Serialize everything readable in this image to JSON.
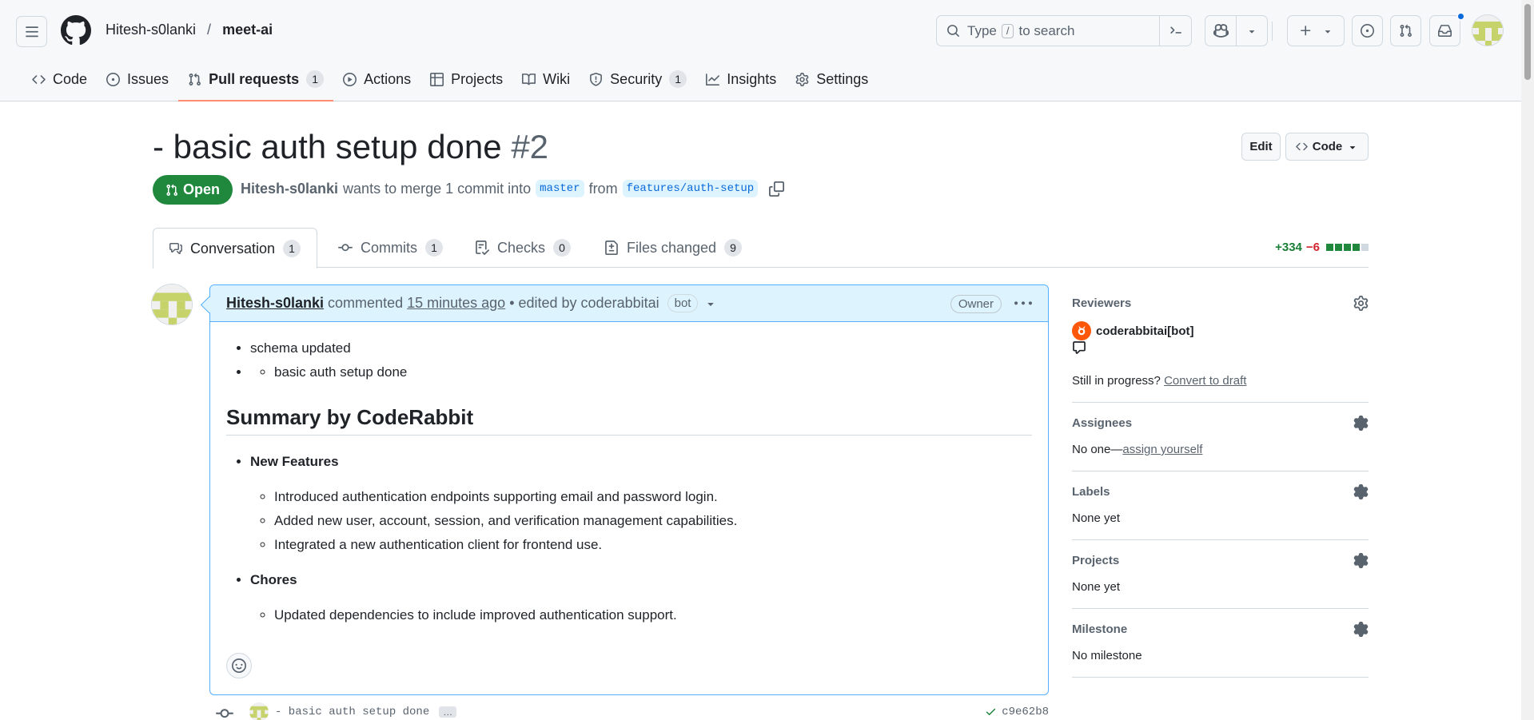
{
  "header": {
    "repo_owner": "Hitesh-s0lanki",
    "repo_separator": "/",
    "repo_name": "meet-ai",
    "search": {
      "prefix": "Type",
      "key": "/",
      "suffix": "to search"
    }
  },
  "repo_nav": [
    {
      "label": "Code",
      "icon": "code-icon"
    },
    {
      "label": "Issues",
      "icon": "issue-opened-icon"
    },
    {
      "label": "Pull requests",
      "icon": "git-pull-request-icon",
      "count": "1",
      "selected": true
    },
    {
      "label": "Actions",
      "icon": "play-icon"
    },
    {
      "label": "Projects",
      "icon": "table-icon"
    },
    {
      "label": "Wiki",
      "icon": "book-icon"
    },
    {
      "label": "Security",
      "icon": "shield-icon",
      "count": "1"
    },
    {
      "label": "Insights",
      "icon": "graph-icon"
    },
    {
      "label": "Settings",
      "icon": "gear-icon"
    }
  ],
  "pr": {
    "title": "- basic auth setup done",
    "number": "#2",
    "edit_label": "Edit",
    "code_label": "Code",
    "state": "Open",
    "author": "Hitesh-s0lanki",
    "merge_text": "wants to merge 1 commit into",
    "base_branch": "master",
    "from_text": "from",
    "head_branch": "features/auth-setup"
  },
  "tabs": [
    {
      "label": "Conversation",
      "count": "1"
    },
    {
      "label": "Commits",
      "count": "1"
    },
    {
      "label": "Checks",
      "count": "0"
    },
    {
      "label": "Files changed",
      "count": "9"
    }
  ],
  "diffstat": {
    "additions": "+334",
    "deletions": "−6",
    "green_blocks": 4,
    "grey_blocks": 1,
    "add_color": "#1a7f37",
    "del_color": "#d1242f"
  },
  "comment": {
    "author": "Hitesh-s0lanki",
    "action": "commented",
    "time": "15 minutes ago",
    "edited": "• edited by coderabbitai",
    "bot_label": "bot",
    "owner_label": "Owner",
    "top_list": {
      "item1": "schema updated",
      "item2": "basic auth setup done"
    },
    "summary_heading": "Summary by CodeRabbit",
    "new_features": {
      "title": "New Features",
      "items": [
        "Introduced authentication endpoints supporting email and password login.",
        "Added new user, account, session, and verification management capabilities.",
        "Integrated a new authentication client for frontend use."
      ]
    },
    "chores": {
      "title": "Chores",
      "items": [
        "Updated dependencies to include improved authentication support."
      ]
    }
  },
  "commit_row": {
    "message": "- basic auth setup done",
    "ellipsis": "…",
    "sha": "c9e62b8"
  },
  "sidebar": {
    "reviewers": {
      "title": "Reviewers",
      "name": "coderabbitai[bot]"
    },
    "draft": {
      "text": "Still in progress?",
      "link": "Convert to draft"
    },
    "assignees": {
      "title": "Assignees",
      "text": "No one—",
      "link": "assign yourself"
    },
    "labels": {
      "title": "Labels",
      "value": "None yet"
    },
    "projects": {
      "title": "Projects",
      "value": "None yet"
    },
    "milestone": {
      "title": "Milestone",
      "value": "No milestone"
    }
  }
}
